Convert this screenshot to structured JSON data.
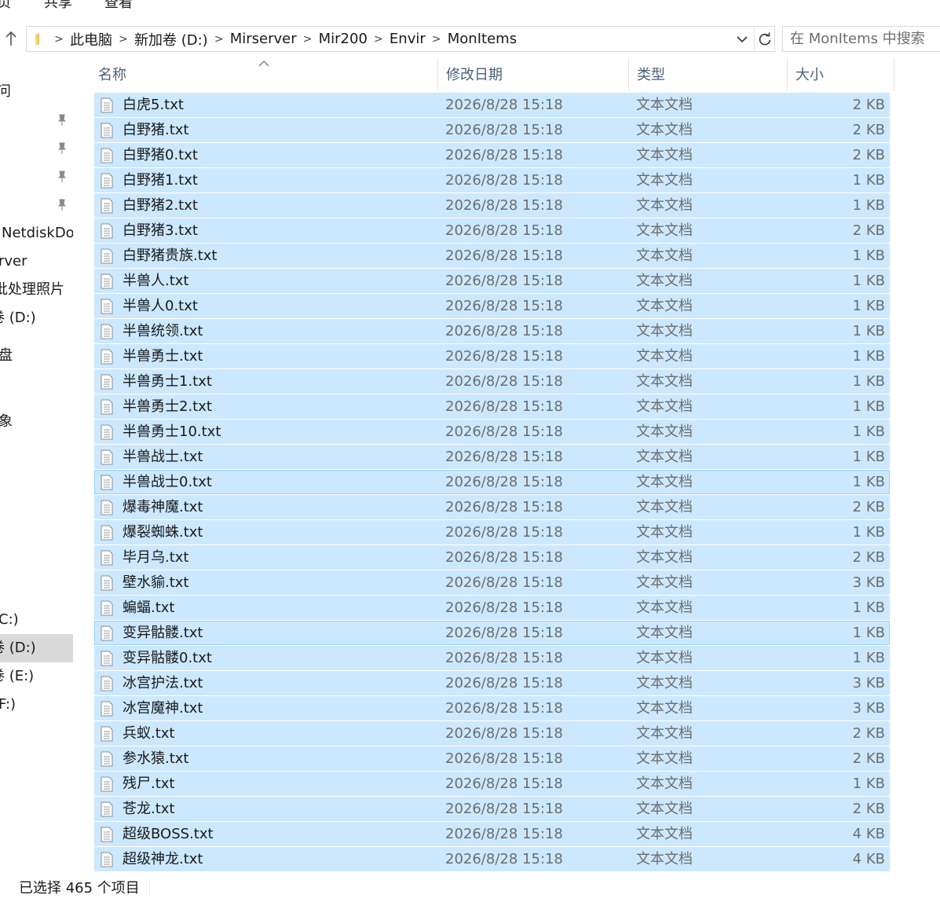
{
  "ribbon": {
    "tabs": [
      "页",
      "共享",
      "查看"
    ]
  },
  "address": {
    "crumbs": [
      "此电脑",
      "新加卷 (D:)",
      "Mirserver",
      "Mir200",
      "Envir",
      "MonItems"
    ]
  },
  "search": {
    "placeholder": "在 MonItems 中搜索"
  },
  "nav": {
    "items": [
      {
        "label": "问",
        "pinned": false
      },
      {
        "label": "",
        "pinned": true
      },
      {
        "label": "",
        "pinned": true
      },
      {
        "label": "",
        "pinned": true
      },
      {
        "label": "",
        "pinned": true
      },
      {
        "label": "NetdiskDo",
        "pinned": false
      },
      {
        "label": "rver",
        "pinned": false
      },
      {
        "label": "批处理照片",
        "pinned": false
      },
      {
        "label": "卷 (D:)",
        "pinned": false
      },
      {
        "label": "盘",
        "pinned": false
      },
      {
        "label": "象",
        "pinned": false
      },
      {
        "label": "C:)",
        "pinned": false
      },
      {
        "label": "卷 (D:)",
        "pinned": false,
        "selected": true
      },
      {
        "label": "卷 (E:)",
        "pinned": false
      },
      {
        "label": "F:)",
        "pinned": false
      }
    ]
  },
  "columns": {
    "name": "名称",
    "date": "修改日期",
    "type": "类型",
    "size": "大小"
  },
  "files": [
    {
      "name": "白虎5.txt",
      "date": "2026/8/28 15:18",
      "type": "文本文档",
      "size": "2 KB"
    },
    {
      "name": "白野猪.txt",
      "date": "2026/8/28 15:18",
      "type": "文本文档",
      "size": "2 KB"
    },
    {
      "name": "白野猪0.txt",
      "date": "2026/8/28 15:18",
      "type": "文本文档",
      "size": "2 KB"
    },
    {
      "name": "白野猪1.txt",
      "date": "2026/8/28 15:18",
      "type": "文本文档",
      "size": "1 KB"
    },
    {
      "name": "白野猪2.txt",
      "date": "2026/8/28 15:18",
      "type": "文本文档",
      "size": "1 KB"
    },
    {
      "name": "白野猪3.txt",
      "date": "2026/8/28 15:18",
      "type": "文本文档",
      "size": "2 KB"
    },
    {
      "name": "白野猪贵族.txt",
      "date": "2026/8/28 15:18",
      "type": "文本文档",
      "size": "1 KB"
    },
    {
      "name": "半兽人.txt",
      "date": "2026/8/28 15:18",
      "type": "文本文档",
      "size": "1 KB"
    },
    {
      "name": "半兽人0.txt",
      "date": "2026/8/28 15:18",
      "type": "文本文档",
      "size": "1 KB"
    },
    {
      "name": "半兽统领.txt",
      "date": "2026/8/28 15:18",
      "type": "文本文档",
      "size": "1 KB"
    },
    {
      "name": "半兽勇士.txt",
      "date": "2026/8/28 15:18",
      "type": "文本文档",
      "size": "1 KB"
    },
    {
      "name": "半兽勇士1.txt",
      "date": "2026/8/28 15:18",
      "type": "文本文档",
      "size": "1 KB"
    },
    {
      "name": "半兽勇士2.txt",
      "date": "2026/8/28 15:18",
      "type": "文本文档",
      "size": "1 KB"
    },
    {
      "name": "半兽勇士10.txt",
      "date": "2026/8/28 15:18",
      "type": "文本文档",
      "size": "1 KB"
    },
    {
      "name": "半兽战士.txt",
      "date": "2026/8/28 15:18",
      "type": "文本文档",
      "size": "1 KB"
    },
    {
      "name": "半兽战士0.txt",
      "date": "2026/8/28 15:18",
      "type": "文本文档",
      "size": "1 KB"
    },
    {
      "name": "爆毒神魔.txt",
      "date": "2026/8/28 15:18",
      "type": "文本文档",
      "size": "2 KB"
    },
    {
      "name": "爆裂蜘蛛.txt",
      "date": "2026/8/28 15:18",
      "type": "文本文档",
      "size": "1 KB"
    },
    {
      "name": "毕月乌.txt",
      "date": "2026/8/28 15:18",
      "type": "文本文档",
      "size": "2 KB"
    },
    {
      "name": "壁水貐.txt",
      "date": "2026/8/28 15:18",
      "type": "文本文档",
      "size": "3 KB"
    },
    {
      "name": "蝙蝠.txt",
      "date": "2026/8/28 15:18",
      "type": "文本文档",
      "size": "1 KB"
    },
    {
      "name": "变异骷髅.txt",
      "date": "2026/8/28 15:18",
      "type": "文本文档",
      "size": "1 KB"
    },
    {
      "name": "变异骷髅0.txt",
      "date": "2026/8/28 15:18",
      "type": "文本文档",
      "size": "1 KB"
    },
    {
      "name": "冰宫护法.txt",
      "date": "2026/8/28 15:18",
      "type": "文本文档",
      "size": "3 KB"
    },
    {
      "name": "冰宫魔神.txt",
      "date": "2026/8/28 15:18",
      "type": "文本文档",
      "size": "3 KB"
    },
    {
      "name": "兵蚁.txt",
      "date": "2026/8/28 15:18",
      "type": "文本文档",
      "size": "2 KB"
    },
    {
      "name": "参水猿.txt",
      "date": "2026/8/28 15:18",
      "type": "文本文档",
      "size": "2 KB"
    },
    {
      "name": "残尸.txt",
      "date": "2026/8/28 15:18",
      "type": "文本文档",
      "size": "1 KB"
    },
    {
      "name": "苍龙.txt",
      "date": "2026/8/28 15:18",
      "type": "文本文档",
      "size": "2 KB"
    },
    {
      "name": "超级BOSS.txt",
      "date": "2026/8/28 15:18",
      "type": "文本文档",
      "size": "4 KB"
    },
    {
      "name": "超级神龙.txt",
      "date": "2026/8/28 15:18",
      "type": "文本文档",
      "size": "4 KB"
    }
  ],
  "status": {
    "text": "已选择 465 个项目"
  },
  "colors": {
    "selection": "#cce8ff",
    "focus_border": "#99d1ff",
    "header_text": "#4c607a",
    "secondary_text": "#6d6d6d"
  }
}
